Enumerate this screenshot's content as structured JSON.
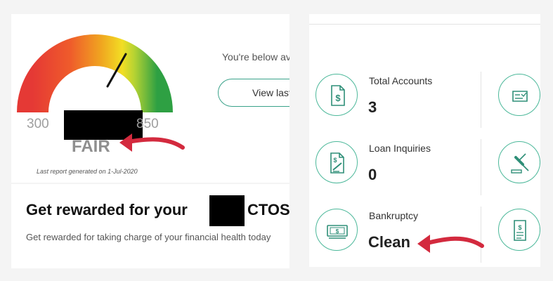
{
  "gauge": {
    "min_label": "300",
    "max_label": "850",
    "rating": "FAIR",
    "last_report": "Last report generated on 1-Jul-2020"
  },
  "summary": {
    "below_text": "You're below av",
    "view_button": "View last"
  },
  "reward": {
    "title": "Get rewarded for your",
    "brand": "CTOS",
    "subtitle": "Get rewarded for taking charge of your financial health today"
  },
  "stats": [
    {
      "label": "Total Accounts",
      "value": "3",
      "icon": "dollar-document-icon"
    },
    {
      "label": "Loan Inquiries",
      "value": "0",
      "icon": "signed-document-icon"
    },
    {
      "label": "Bankruptcy",
      "value": "Clean",
      "icon": "cash-icon"
    }
  ],
  "right_icons": [
    "credit-card-check-icon",
    "gavel-icon",
    "bill-icon"
  ],
  "colors": {
    "accent": "#4cb89a",
    "arrow": "#d32a3e"
  }
}
